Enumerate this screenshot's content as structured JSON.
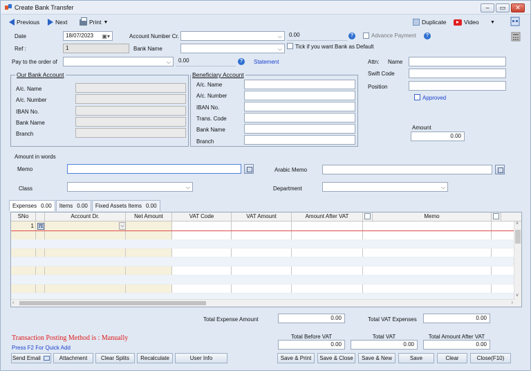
{
  "window": {
    "title": "Create Bank Transfer"
  },
  "toolbar": {
    "previous": "Previous",
    "next": "Next",
    "print": "Print",
    "duplicate": "Duplicate",
    "video": "Video"
  },
  "header": {
    "date_label": "Date",
    "date_value": "18/07/2023",
    "ref_label": "Ref :",
    "ref_value": "1",
    "account_number_cr_label": "Account Number Cr.",
    "account_number_cr_value": "",
    "amount_cr_value": "0.00",
    "advance_payment_label": "Advance Payment",
    "bank_name_label": "Bank Name",
    "bank_name_value": "",
    "tick_default_label": "Tick if you want Bank as Default",
    "pay_to_label": "Pay to the order of",
    "pay_to_value": "",
    "pay_amount_value": "0.00",
    "statement_link": "Statement"
  },
  "our_bank": {
    "title": "Our Bank Account",
    "labels": [
      "A/c. Name",
      "A/c. Number",
      "IBAN No.",
      "Bank Name",
      "Branch"
    ],
    "values": [
      "",
      "",
      "",
      "",
      ""
    ]
  },
  "beneficiary": {
    "title": "Beneficiary Account",
    "labels": [
      "A/c. Name",
      "A/c. Number",
      "IBAN No.",
      "Trans. Code",
      "Bank Name",
      "Branch"
    ],
    "values": [
      "",
      "",
      "",
      "",
      "",
      ""
    ]
  },
  "right_panel": {
    "attn_label": "Attn:",
    "name_label": "Name",
    "name_value": "",
    "swift_label": "Swift Code",
    "swift_value": "",
    "position_label": "Position",
    "position_value": "",
    "approved_label": "Approved",
    "amount_label": "Amount",
    "amount_value": "0.00"
  },
  "mid": {
    "amount_in_words_label": "Amount in words",
    "memo_label": "Memo",
    "memo_value": "",
    "arabic_memo_label": "Arabic Memo",
    "arabic_memo_value": "",
    "class_label": "Class",
    "class_value": "",
    "department_label": "Department",
    "department_value": ""
  },
  "tabs": [
    {
      "label": "Expenses",
      "count": "0.00"
    },
    {
      "label": "Items",
      "count": "0.00"
    },
    {
      "label": "Fixed Assets Items",
      "count": "0.00"
    }
  ],
  "grid": {
    "columns": [
      "SNo",
      "",
      "Account Dr.",
      "Net Amount",
      "VAT Code",
      "VAT Amount",
      "Amount After VAT",
      "",
      "Memo",
      ""
    ],
    "first_row_sno": "1"
  },
  "totals": {
    "total_expense_label": "Total Expense Amount",
    "total_expense_value": "0.00",
    "total_vat_expenses_label": "Total VAT Expenses",
    "total_vat_expenses_value": "0.00",
    "total_before_vat_label": "Total Before VAT",
    "total_before_vat_value": "0.00",
    "total_vat_label": "Total VAT",
    "total_vat_value": "0.00",
    "total_after_vat_label": "Total Amount After VAT",
    "total_after_vat_value": "0.00"
  },
  "footer": {
    "posting_method": "Transaction Posting Method is : Manually",
    "quick_add_hint": "Press F2 For Quick Add",
    "send_email": "Send Email",
    "attachment": "Attachment",
    "clear_splits": "Clear Splits",
    "recalculate": "Recalculate",
    "user_info": "User Info",
    "save_print": "Save & Print",
    "save_close": "Save & Close",
    "save_new": "Save & New",
    "save": "Save",
    "clear": "Clear",
    "close": "Close(F10)"
  },
  "colors": {
    "accent": "#2b63c7",
    "warning_text": "#e01b1b",
    "link": "#1a3fd0",
    "grid_tint": "#f6f1dc"
  }
}
